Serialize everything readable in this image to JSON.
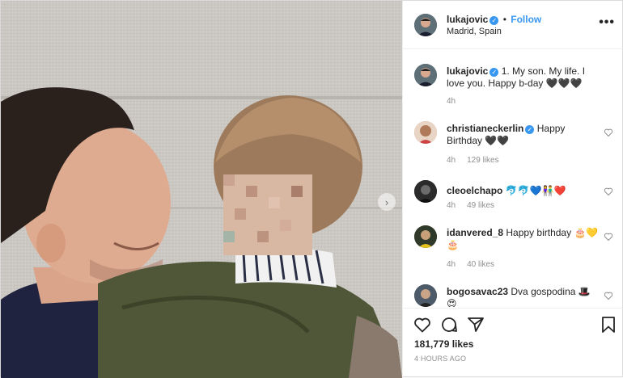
{
  "post": {
    "author": "lukajovic",
    "location": "Madrid, Spain",
    "follow_label": "Follow",
    "dot": "•",
    "more": "•••",
    "next_arrow": "›",
    "likes": "181,779 likes",
    "time_ago": "4 HOURS AGO"
  },
  "caption": {
    "username": "lukajovic",
    "text": "1. My son. My life. I love you. Happy b-day 🖤🖤🖤",
    "time": "4h"
  },
  "comments": [
    {
      "username": "christianeckerlin",
      "verified": true,
      "text": "Happy Birthday 🖤🖤",
      "time": "4h",
      "likes": "129 likes",
      "avatar_color": "#b07a5a"
    },
    {
      "username": "cleoelchapo",
      "verified": false,
      "text": "🐬🐬💙👫❤️",
      "time": "4h",
      "likes": "49 likes",
      "avatar_color": "#2b2b2b"
    },
    {
      "username": "idanvered_8",
      "verified": false,
      "text": "Happy birthday 🎂💛🎂",
      "time": "4h",
      "likes": "40 likes",
      "avatar_color": "#7a6a2a"
    },
    {
      "username": "bogosavac23",
      "verified": false,
      "text": "Dva gospodina 🎩😍",
      "time": "",
      "likes": "",
      "avatar_color": "#5a4a3a"
    }
  ],
  "verified_mark": "✓",
  "icons": [
    "heart-icon",
    "comment-icon",
    "share-icon",
    "bookmark-icon",
    "more-options-icon",
    "chevron-right-icon"
  ],
  "colors": {
    "accent": "#3897f0",
    "muted": "#8e8e8e",
    "text": "#262626"
  }
}
